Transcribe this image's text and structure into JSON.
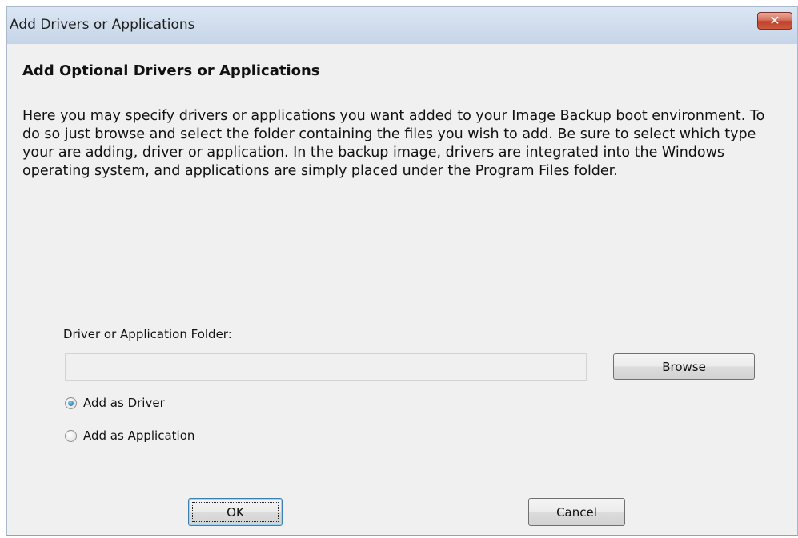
{
  "window": {
    "title": "Add Drivers or Applications",
    "close_glyph": "✕"
  },
  "content": {
    "heading": "Add Optional Drivers or Applications",
    "description": "Here you may specify drivers or applications you want added to your Image Backup boot environment. To do so just browse and select the folder containing the files you wish to add. Be sure to select which type your are adding, driver or application. In the backup image, drivers are integrated into the Windows operating system, and applications are simply placed under the Program Files folder."
  },
  "folder": {
    "label": "Driver or Application Folder:",
    "value": "",
    "browse_label": "Browse"
  },
  "radios": {
    "driver_label": "Add as Driver",
    "driver_checked": true,
    "application_label": "Add as Application",
    "application_checked": false
  },
  "buttons": {
    "ok_label": "OK",
    "cancel_label": "Cancel"
  },
  "colors": {
    "titlebar": "#c5d5e8",
    "dialog_background": "#f0f0f0",
    "close_button": "#c2402a",
    "default_button_border": "#3c7fb1"
  }
}
